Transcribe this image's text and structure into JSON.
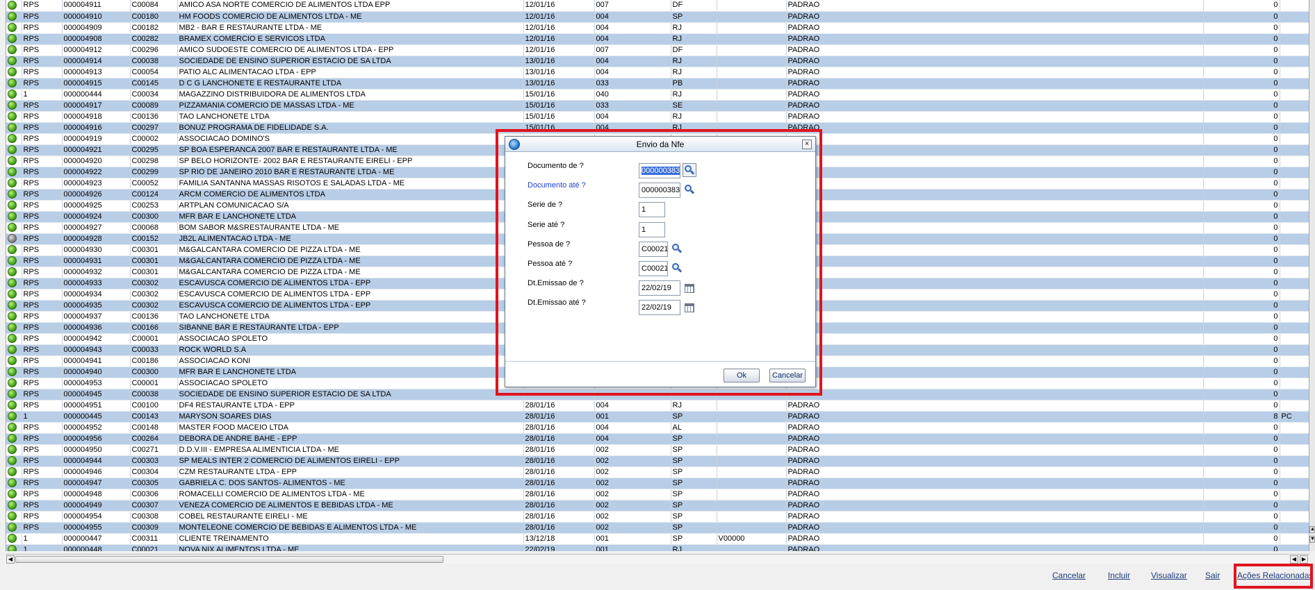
{
  "grid": {
    "rows": [
      {
        "status": "green",
        "serie": "RPS",
        "doc": "000004911",
        "cliente": "C00084",
        "nome": "AMICO ASA NORTE COMERCIO DE ALIMENTOS LTDA EPP",
        "data": "12/01/16",
        "cod": "007",
        "uf": "DF",
        "vend": "",
        "tabela": "PADRAO",
        "valor": "0",
        "extra": ""
      },
      {
        "status": "green",
        "serie": "RPS",
        "doc": "000004910",
        "cliente": "C00180",
        "nome": "HM FOODS COMERCIO DE ALIMENTOS LTDA - ME",
        "data": "12/01/16",
        "cod": "004",
        "uf": "SP",
        "vend": "",
        "tabela": "PADRAO",
        "valor": "0",
        "extra": ""
      },
      {
        "status": "green",
        "serie": "RPS",
        "doc": "000004909",
        "cliente": "C00182",
        "nome": "MB2 - BAR E RESTAURANTE LTDA - ME",
        "data": "12/01/16",
        "cod": "004",
        "uf": "RJ",
        "vend": "",
        "tabela": "PADRAO",
        "valor": "0",
        "extra": ""
      },
      {
        "status": "green",
        "serie": "RPS",
        "doc": "000004908",
        "cliente": "C00282",
        "nome": "BRAMEX COMERCIO E SERVICOS LTDA",
        "data": "12/01/16",
        "cod": "004",
        "uf": "RJ",
        "vend": "",
        "tabela": "PADRAO",
        "valor": "0",
        "extra": ""
      },
      {
        "status": "green",
        "serie": "RPS",
        "doc": "000004912",
        "cliente": "C00296",
        "nome": "AMICO SUDOESTE COMERCIO DE ALIMENTOS LTDA - EPP",
        "data": "12/01/16",
        "cod": "007",
        "uf": "DF",
        "vend": "",
        "tabela": "PADRAO",
        "valor": "0",
        "extra": ""
      },
      {
        "status": "green",
        "serie": "RPS",
        "doc": "000004914",
        "cliente": "C00038",
        "nome": "SOCIEDADE DE ENSINO SUPERIOR ESTACIO DE SA LTDA",
        "data": "13/01/16",
        "cod": "004",
        "uf": "RJ",
        "vend": "",
        "tabela": "PADRAO",
        "valor": "0",
        "extra": ""
      },
      {
        "status": "green",
        "serie": "RPS",
        "doc": "000004913",
        "cliente": "C00054",
        "nome": "PATIO ALC ALIMENTACAO LTDA - EPP",
        "data": "13/01/16",
        "cod": "004",
        "uf": "RJ",
        "vend": "",
        "tabela": "PADRAO",
        "valor": "0",
        "extra": ""
      },
      {
        "status": "green",
        "serie": "RPS",
        "doc": "000004915",
        "cliente": "C00145",
        "nome": "D C G LANCHONETE E RESTAURANTE LTDA",
        "data": "13/01/16",
        "cod": "033",
        "uf": "PB",
        "vend": "",
        "tabela": "PADRAO",
        "valor": "0",
        "extra": ""
      },
      {
        "status": "green",
        "serie": "1",
        "doc": "000000444",
        "cliente": "C00034",
        "nome": "MAGAZZINO DISTRIBUIDORA DE ALIMENTOS LTDA",
        "data": "15/01/16",
        "cod": "040",
        "uf": "RJ",
        "vend": "",
        "tabela": "PADRAO",
        "valor": "0",
        "extra": ""
      },
      {
        "status": "green",
        "serie": "RPS",
        "doc": "000004917",
        "cliente": "C00089",
        "nome": "PIZZAMANIA COMERCIO DE MASSAS LTDA - ME",
        "data": "15/01/16",
        "cod": "033",
        "uf": "SE",
        "vend": "",
        "tabela": "PADRAO",
        "valor": "0",
        "extra": ""
      },
      {
        "status": "green",
        "serie": "RPS",
        "doc": "000004918",
        "cliente": "C00136",
        "nome": "TAO LANCHONETE LTDA",
        "data": "15/01/16",
        "cod": "004",
        "uf": "RJ",
        "vend": "",
        "tabela": "PADRAO",
        "valor": "0",
        "extra": ""
      },
      {
        "status": "green",
        "serie": "RPS",
        "doc": "000004916",
        "cliente": "C00297",
        "nome": "BONUZ PROGRAMA DE FIDELIDADE S.A.",
        "data": "15/01/16",
        "cod": "004",
        "uf": "RJ",
        "vend": "",
        "tabela": "PADRAO",
        "valor": "0",
        "extra": ""
      },
      {
        "status": "green",
        "serie": "RPS",
        "doc": "000004919",
        "cliente": "C00002",
        "nome": "ASSOCIACAO DOMINO'S",
        "data": "",
        "cod": "",
        "uf": "",
        "vend": "",
        "tabela": "",
        "valor": "0",
        "extra": ""
      },
      {
        "status": "green",
        "serie": "RPS",
        "doc": "000004921",
        "cliente": "C00295",
        "nome": "SP BOA ESPERANCA 2007 BAR E RESTAURANTE LTDA - ME",
        "data": "",
        "cod": "",
        "uf": "",
        "vend": "",
        "tabela": "",
        "valor": "0",
        "extra": ""
      },
      {
        "status": "green",
        "serie": "RPS",
        "doc": "000004920",
        "cliente": "C00298",
        "nome": "SP BELO HORIZONTE- 2002 BAR E RESTAURANTE EIRELI - EPP",
        "data": "",
        "cod": "",
        "uf": "",
        "vend": "",
        "tabela": "",
        "valor": "0",
        "extra": ""
      },
      {
        "status": "green",
        "serie": "RPS",
        "doc": "000004922",
        "cliente": "C00299",
        "nome": "SP RIO DE JANEIRO 2010 BAR E RESTAURANTE LTDA - ME",
        "data": "",
        "cod": "",
        "uf": "",
        "vend": "",
        "tabela": "",
        "valor": "0",
        "extra": ""
      },
      {
        "status": "green",
        "serie": "RPS",
        "doc": "000004923",
        "cliente": "C00052",
        "nome": "FAMILIA SANTANNA MASSAS RISOTOS E SALADAS LTDA - ME",
        "data": "",
        "cod": "",
        "uf": "",
        "vend": "",
        "tabela": "",
        "valor": "0",
        "extra": ""
      },
      {
        "status": "green",
        "serie": "RPS",
        "doc": "000004926",
        "cliente": "C00124",
        "nome": "ARCM COMERCIO DE ALIMENTOS LTDA",
        "data": "",
        "cod": "",
        "uf": "",
        "vend": "",
        "tabela": "",
        "valor": "0",
        "extra": ""
      },
      {
        "status": "green",
        "serie": "RPS",
        "doc": "000004925",
        "cliente": "C00253",
        "nome": "ARTPLAN COMUNICACAO S/A",
        "data": "",
        "cod": "",
        "uf": "",
        "vend": "",
        "tabela": "",
        "valor": "0",
        "extra": ""
      },
      {
        "status": "green",
        "serie": "RPS",
        "doc": "000004924",
        "cliente": "C00300",
        "nome": "MFR BAR E LANCHONETE LTDA",
        "data": "",
        "cod": "",
        "uf": "",
        "vend": "",
        "tabela": "",
        "valor": "0",
        "extra": ""
      },
      {
        "status": "green",
        "serie": "RPS",
        "doc": "000004927",
        "cliente": "C00068",
        "nome": "BOM SABOR M&SRESTAURANTE LTDA - ME",
        "data": "",
        "cod": "",
        "uf": "",
        "vend": "",
        "tabela": "",
        "valor": "0",
        "extra": ""
      },
      {
        "status": "gray",
        "serie": "RPS",
        "doc": "000004928",
        "cliente": "C00152",
        "nome": "JB2L ALIMENTACAO LTDA - ME",
        "data": "",
        "cod": "",
        "uf": "",
        "vend": "",
        "tabela": "",
        "valor": "0",
        "extra": ""
      },
      {
        "status": "green",
        "serie": "RPS",
        "doc": "000004930",
        "cliente": "C00301",
        "nome": "M&GALCANTARA COMERCIO DE PIZZA LTDA - ME",
        "data": "",
        "cod": "",
        "uf": "",
        "vend": "",
        "tabela": "",
        "valor": "0",
        "extra": ""
      },
      {
        "status": "green",
        "serie": "RPS",
        "doc": "000004931",
        "cliente": "C00301",
        "nome": "M&GALCANTARA COMERCIO DE PIZZA LTDA - ME",
        "data": "",
        "cod": "",
        "uf": "",
        "vend": "",
        "tabela": "",
        "valor": "0",
        "extra": ""
      },
      {
        "status": "green",
        "serie": "RPS",
        "doc": "000004932",
        "cliente": "C00301",
        "nome": "M&GALCANTARA COMERCIO DE PIZZA LTDA - ME",
        "data": "",
        "cod": "",
        "uf": "",
        "vend": "",
        "tabela": "",
        "valor": "0",
        "extra": ""
      },
      {
        "status": "green",
        "serie": "RPS",
        "doc": "000004933",
        "cliente": "C00302",
        "nome": "ESCAVUSCA COMERCIO DE ALIMENTOS LTDA - EPP",
        "data": "",
        "cod": "",
        "uf": "",
        "vend": "",
        "tabela": "",
        "valor": "0",
        "extra": ""
      },
      {
        "status": "green",
        "serie": "RPS",
        "doc": "000004934",
        "cliente": "C00302",
        "nome": "ESCAVUSCA COMERCIO DE ALIMENTOS LTDA - EPP",
        "data": "",
        "cod": "",
        "uf": "",
        "vend": "",
        "tabela": "",
        "valor": "0",
        "extra": ""
      },
      {
        "status": "green",
        "serie": "RPS",
        "doc": "000004935",
        "cliente": "C00302",
        "nome": "ESCAVUSCA COMERCIO DE ALIMENTOS LTDA - EPP",
        "data": "",
        "cod": "",
        "uf": "",
        "vend": "",
        "tabela": "",
        "valor": "0",
        "extra": ""
      },
      {
        "status": "green",
        "serie": "RPS",
        "doc": "000004937",
        "cliente": "C00136",
        "nome": "TAO LANCHONETE LTDA",
        "data": "",
        "cod": "",
        "uf": "",
        "vend": "",
        "tabela": "",
        "valor": "0",
        "extra": ""
      },
      {
        "status": "green",
        "serie": "RPS",
        "doc": "000004936",
        "cliente": "C00166",
        "nome": "SIBANNE BAR E RESTAURANTE LTDA - EPP",
        "data": "",
        "cod": "",
        "uf": "",
        "vend": "",
        "tabela": "",
        "valor": "0",
        "extra": ""
      },
      {
        "status": "green",
        "serie": "RPS",
        "doc": "000004942",
        "cliente": "C00001",
        "nome": "ASSOCIACAO SPOLETO",
        "data": "",
        "cod": "",
        "uf": "",
        "vend": "",
        "tabela": "",
        "valor": "0",
        "extra": ""
      },
      {
        "status": "green",
        "serie": "RPS",
        "doc": "000004943",
        "cliente": "C00033",
        "nome": "ROCK WORLD S.A",
        "data": "",
        "cod": "",
        "uf": "",
        "vend": "",
        "tabela": "",
        "valor": "0",
        "extra": ""
      },
      {
        "status": "green",
        "serie": "RPS",
        "doc": "000004941",
        "cliente": "C00186",
        "nome": "ASSOCIACAO KONI",
        "data": "",
        "cod": "",
        "uf": "",
        "vend": "",
        "tabela": "",
        "valor": "0",
        "extra": ""
      },
      {
        "status": "green",
        "serie": "RPS",
        "doc": "000004940",
        "cliente": "C00300",
        "nome": "MFR BAR E LANCHONETE LTDA",
        "data": "",
        "cod": "",
        "uf": "",
        "vend": "",
        "tabela": "",
        "valor": "0",
        "extra": ""
      },
      {
        "status": "green",
        "serie": "RPS",
        "doc": "000004953",
        "cliente": "C00001",
        "nome": "ASSOCIACAO SPOLETO",
        "data": "",
        "cod": "",
        "uf": "",
        "vend": "",
        "tabela": "",
        "valor": "0",
        "extra": ""
      },
      {
        "status": "green",
        "serie": "RPS",
        "doc": "000004945",
        "cliente": "C00038",
        "nome": "SOCIEDADE DE ENSINO SUPERIOR ESTACIO DE SA LTDA",
        "data": "",
        "cod": "",
        "uf": "",
        "vend": "",
        "tabela": "",
        "valor": "0",
        "extra": ""
      },
      {
        "status": "green",
        "serie": "RPS",
        "doc": "000004951",
        "cliente": "C00100",
        "nome": "DF4 RESTAURANTE LTDA - EPP",
        "data": "28/01/16",
        "cod": "004",
        "uf": "RJ",
        "vend": "",
        "tabela": "PADRAO",
        "valor": "0",
        "extra": ""
      },
      {
        "status": "green",
        "serie": "1",
        "doc": "000000445",
        "cliente": "C00143",
        "nome": "MARYSON SOARES DIAS",
        "data": "28/01/16",
        "cod": "001",
        "uf": "SP",
        "vend": "",
        "tabela": "PADRAO",
        "valor": "8",
        "extra": "PC"
      },
      {
        "status": "green",
        "serie": "RPS",
        "doc": "000004952",
        "cliente": "C00148",
        "nome": "MASTER FOOD MACEIO LTDA",
        "data": "28/01/16",
        "cod": "004",
        "uf": "AL",
        "vend": "",
        "tabela": "PADRAO",
        "valor": "0",
        "extra": ""
      },
      {
        "status": "green",
        "serie": "RPS",
        "doc": "000004956",
        "cliente": "C00264",
        "nome": "DEBORA DE ANDRE BAHE - EPP",
        "data": "28/01/16",
        "cod": "004",
        "uf": "SP",
        "vend": "",
        "tabela": "PADRAO",
        "valor": "0",
        "extra": ""
      },
      {
        "status": "green",
        "serie": "RPS",
        "doc": "000004950",
        "cliente": "C00271",
        "nome": "D.D.V.III - EMPRESA ALIMENTICIA LTDA - ME",
        "data": "28/01/16",
        "cod": "002",
        "uf": "SP",
        "vend": "",
        "tabela": "PADRAO",
        "valor": "0",
        "extra": ""
      },
      {
        "status": "green",
        "serie": "RPS",
        "doc": "000004944",
        "cliente": "C00303",
        "nome": "SP MEALS INTER 2 COMERCIO DE ALIMENTOS EIRELI - EPP",
        "data": "28/01/16",
        "cod": "002",
        "uf": "SP",
        "vend": "",
        "tabela": "PADRAO",
        "valor": "0",
        "extra": ""
      },
      {
        "status": "green",
        "serie": "RPS",
        "doc": "000004946",
        "cliente": "C00304",
        "nome": "CZM RESTAURANTE LTDA - EPP",
        "data": "28/01/16",
        "cod": "002",
        "uf": "SP",
        "vend": "",
        "tabela": "PADRAO",
        "valor": "0",
        "extra": ""
      },
      {
        "status": "green",
        "serie": "RPS",
        "doc": "000004947",
        "cliente": "C00305",
        "nome": "GABRIELA C. DOS SANTOS- ALIMENTOS - ME",
        "data": "28/01/16",
        "cod": "002",
        "uf": "SP",
        "vend": "",
        "tabela": "PADRAO",
        "valor": "0",
        "extra": ""
      },
      {
        "status": "green",
        "serie": "RPS",
        "doc": "000004948",
        "cliente": "C00306",
        "nome": "ROMACELLI COMERCIO DE ALIMENTOS LTDA - ME",
        "data": "28/01/16",
        "cod": "002",
        "uf": "SP",
        "vend": "",
        "tabela": "PADRAO",
        "valor": "0",
        "extra": ""
      },
      {
        "status": "green",
        "serie": "RPS",
        "doc": "000004949",
        "cliente": "C00307",
        "nome": "VENEZA COMERCIO DE ALIMENTOS E BEBIDAS LTDA - ME",
        "data": "28/01/16",
        "cod": "002",
        "uf": "SP",
        "vend": "",
        "tabela": "PADRAO",
        "valor": "0",
        "extra": ""
      },
      {
        "status": "green",
        "serie": "RPS",
        "doc": "000004954",
        "cliente": "C00308",
        "nome": "COBEL RESTAURANTE EIRELI - ME",
        "data": "28/01/16",
        "cod": "002",
        "uf": "SP",
        "vend": "",
        "tabela": "PADRAO",
        "valor": "0",
        "extra": ""
      },
      {
        "status": "green",
        "serie": "RPS",
        "doc": "000004955",
        "cliente": "C00309",
        "nome": "MONTELEONE COMERCIO DE BEBIDAS E ALIMENTOS LTDA - ME",
        "data": "28/01/16",
        "cod": "002",
        "uf": "SP",
        "vend": "",
        "tabela": "PADRAO",
        "valor": "0",
        "extra": ""
      },
      {
        "status": "green",
        "serie": "1",
        "doc": "000000447",
        "cliente": "C00311",
        "nome": "CLIENTE TREINAMENTO",
        "data": "13/12/18",
        "cod": "001",
        "uf": "SP",
        "vend": "V00000",
        "tabela": "PADRAO",
        "valor": "0",
        "extra": ""
      },
      {
        "status": "green",
        "serie": "1",
        "doc": "000000448",
        "cliente": "C00021",
        "nome": "NOVA NIX ALIMENTOS LTDA - ME",
        "data": "22/02/19",
        "cod": "001",
        "uf": "RJ",
        "vend": "",
        "tabela": "PADRAO",
        "valor": "0",
        "extra": ""
      }
    ]
  },
  "dialog": {
    "title": "Envio da Nfe",
    "close_label": "×",
    "fields": [
      {
        "label": "Documento de ?",
        "value": "000000383",
        "lookup": true,
        "calendar": false,
        "selected": true,
        "highlight": false
      },
      {
        "label": "Documento até ?",
        "value": "000000383",
        "lookup": true,
        "calendar": false,
        "selected": false,
        "highlight": true
      },
      {
        "label": "Serie de ?",
        "value": "1",
        "lookup": false,
        "calendar": false,
        "selected": false,
        "highlight": false
      },
      {
        "label": "Serie até ?",
        "value": "1",
        "lookup": false,
        "calendar": false,
        "selected": false,
        "highlight": false
      },
      {
        "label": "Pessoa de ?",
        "value": "C00021",
        "lookup": true,
        "calendar": false,
        "selected": false,
        "highlight": false
      },
      {
        "label": "Pessoa até ?",
        "value": "C00021",
        "lookup": true,
        "calendar": false,
        "selected": false,
        "highlight": false
      },
      {
        "label": "Dt.Emissao de ?",
        "value": "22/02/19",
        "lookup": false,
        "calendar": true,
        "selected": false,
        "highlight": false
      },
      {
        "label": "Dt.Emissao até ?",
        "value": "22/02/19",
        "lookup": false,
        "calendar": true,
        "selected": false,
        "highlight": false
      }
    ],
    "ok_label": "Ok",
    "cancel_label": "Cancelar"
  },
  "footer": {
    "cancelar": "Cancelar",
    "incluir": "Incluir",
    "visualizar": "Visualizar",
    "sair": "Sair",
    "acoes": "Ações Relacionadas"
  },
  "colors": {
    "highlight_frame": "#e0141e",
    "row_alt": "#b8cde6",
    "link": "#1d3a7a"
  }
}
